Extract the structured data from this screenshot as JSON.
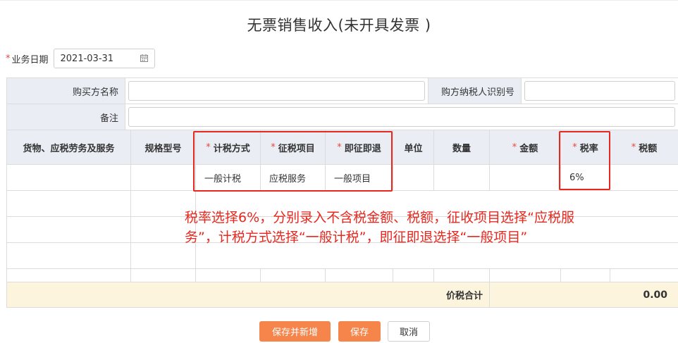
{
  "page": {
    "title": "无票销售收入(未开具发票 )"
  },
  "date": {
    "required_mark": "*",
    "label": "业务日期",
    "value": "2021-03-31",
    "icon": "calendar-icon"
  },
  "form": {
    "buyer_name_label": "购买方名称",
    "buyer_name_value": "",
    "buyer_taxid_label": "购方纳税人识别号",
    "buyer_taxid_value": "",
    "remark_label": "备注",
    "remark_value": ""
  },
  "table": {
    "headers": [
      {
        "label": "货物、应税劳务及服务",
        "required": false
      },
      {
        "label": "规格型号",
        "required": false
      },
      {
        "label": "计税方式",
        "required": true
      },
      {
        "label": "征税项目",
        "required": true
      },
      {
        "label": "即征即退",
        "required": true
      },
      {
        "label": "单位",
        "required": false
      },
      {
        "label": "数量",
        "required": false
      },
      {
        "label": "金额",
        "required": true
      },
      {
        "label": "税率",
        "required": true
      },
      {
        "label": "税额",
        "required": true
      }
    ],
    "required_mark": "*",
    "row1": {
      "goods": "",
      "spec": "",
      "tax_method": "一般计税",
      "tax_item": "应税服务",
      "refund": "一般项目",
      "unit": "",
      "qty": "",
      "amount": "",
      "rate": "6%",
      "tax": ""
    },
    "total_label": "价税合计",
    "total_value": "0.00"
  },
  "annotation": {
    "line1": "税率选择6%，分别录入不含税金额、税额，征收项目选择“应税服",
    "line2": "务”，计税方式选择“一般计税”，即征即退选择“一般项目”",
    "color": "#e8281e"
  },
  "buttons": {
    "save_new": "保存并新增",
    "save": "保存",
    "cancel": "取消"
  },
  "colors": {
    "accent": "#f5854a",
    "header_bg": "#eaeef4",
    "total_bg": "#fcf4dc",
    "required": "#e8483a"
  }
}
